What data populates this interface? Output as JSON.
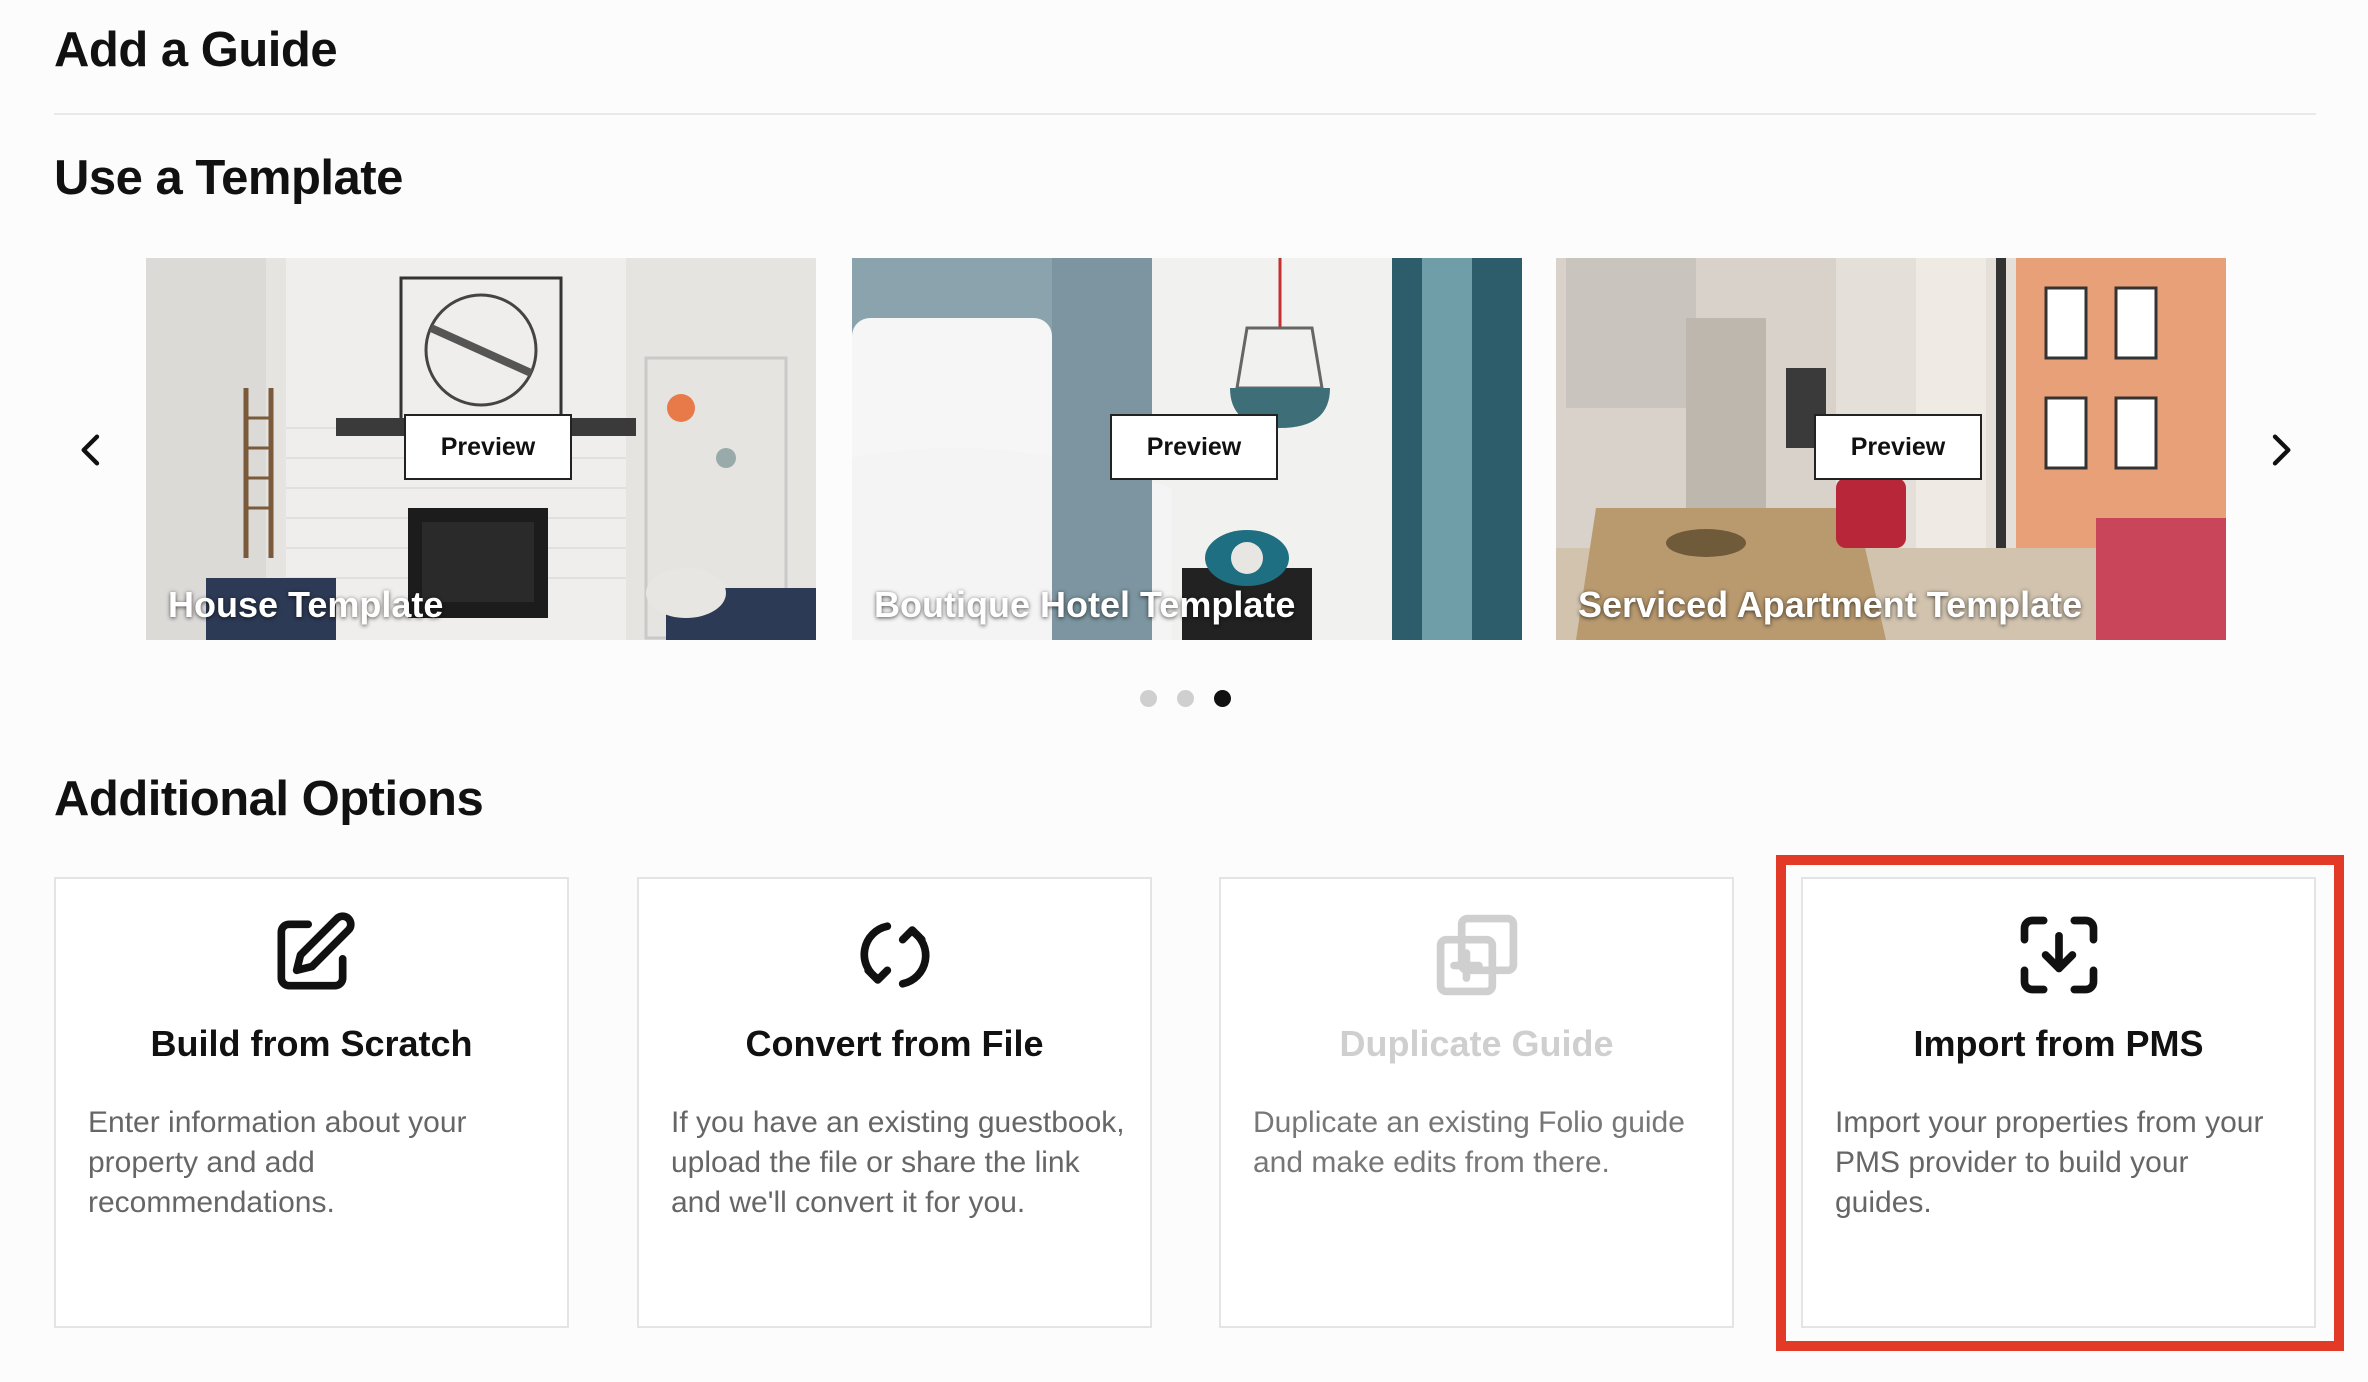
{
  "page": {
    "title": "Add a Guide"
  },
  "templates": {
    "heading": "Use a Template",
    "preview_label": "Preview",
    "cards": [
      {
        "label": "House Template"
      },
      {
        "label": "Boutique Hotel Template"
      },
      {
        "label": "Serviced Apartment Template"
      }
    ],
    "active_page": 3,
    "total_pages": 3
  },
  "options": {
    "heading": "Additional Options",
    "items": [
      {
        "title": "Build from Scratch",
        "description": "Enter information about your property and add recommendations.",
        "icon": "edit-icon",
        "disabled": false
      },
      {
        "title": "Convert from File",
        "description": "If you have an existing guestbook, upload the file or share the link and we'll convert it for you.",
        "icon": "convert-icon",
        "disabled": false
      },
      {
        "title": "Duplicate Guide",
        "description": "Duplicate an existing Folio guide and make edits from there.",
        "icon": "duplicate-icon",
        "disabled": true
      },
      {
        "title": "Import from PMS",
        "description": "Import your properties from your PMS provider to build your guides.",
        "icon": "import-icon",
        "disabled": false
      }
    ]
  },
  "colors": {
    "highlight": "#e23a26",
    "text": "#111111",
    "muted": "#666666",
    "disabled": "#cfcfcf"
  }
}
